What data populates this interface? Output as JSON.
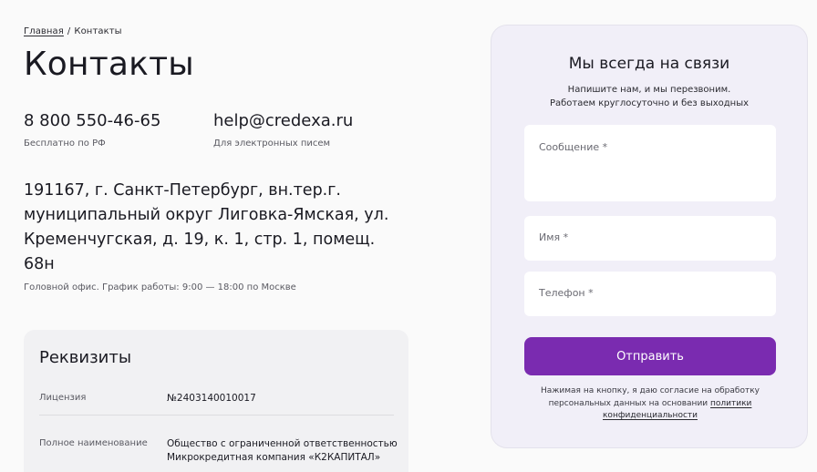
{
  "breadcrumb": {
    "home": "Главная",
    "separator": "/",
    "current": "Контакты"
  },
  "page_title": "Контакты",
  "contacts": {
    "phone": {
      "value": "8 800 550-46-65",
      "caption": "Бесплатно по РФ"
    },
    "email": {
      "value": "help@credexa.ru",
      "caption": "Для электронных писем"
    }
  },
  "address": "191167, г. Санкт-Петербург, вн.тер.г. муниципальный округ Лиговка-Ямская, ул. Кременчугская, д. 19, к. 1, стр. 1, помещ. 68н",
  "office_note": "Головной офис. График работы: 9:00 — 18:00 по Москве",
  "requisites": {
    "title": "Реквизиты",
    "rows": [
      {
        "label": "Лицензия",
        "value": "№2403140010017"
      },
      {
        "label": "Полное наименование",
        "value": "Общество с ограниченной ответственностью Микрокредитная компания «К2КАПИТАЛ»"
      }
    ]
  },
  "form": {
    "title": "Мы всегда на связи",
    "subtitle_line1": "Напишите нам, и мы перезвоним.",
    "subtitle_line2": "Работаем круглосуточно и без выходных",
    "message_placeholder": "Сообщение *",
    "name_placeholder": "Имя *",
    "phone_placeholder": "Телефон *",
    "submit_label": "Отправить",
    "consent_text": "Нажимая на кнопку, я даю согласие на обработку персональных данных на основании",
    "consent_link": "политики конфиденциальности"
  },
  "colors": {
    "accent": "#7a2bb0",
    "card_bg": "#f1eff8",
    "page_bg": "#fafafa"
  }
}
